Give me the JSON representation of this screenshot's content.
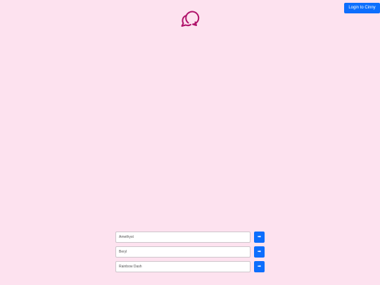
{
  "header": {
    "login_label": "Login to Cinny",
    "accent_color": "#0d6efd"
  },
  "logo": {
    "icon": "chat-bubbles-icon",
    "color": "#b0126a"
  },
  "background_color": "#fde2ef",
  "rows": [
    {
      "placeholder": "Amethyst",
      "submit_symbol": "➡",
      "submit_icon": "arrow-right-icon"
    },
    {
      "placeholder": "Beryl",
      "submit_symbol": "➡",
      "submit_icon": "arrow-right-icon"
    },
    {
      "placeholder": "Rainbow Dash",
      "submit_symbol": "➡",
      "submit_icon": "arrow-right-icon"
    }
  ]
}
